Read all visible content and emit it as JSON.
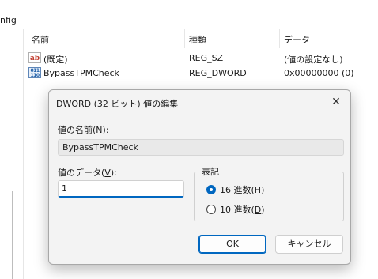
{
  "address": {
    "text": "nfig"
  },
  "list": {
    "columns": {
      "name": "名前",
      "type": "種類",
      "data": "データ"
    },
    "rows": [
      {
        "icon": "ab",
        "name": "(既定)",
        "type": "REG_SZ",
        "data": "(値の設定なし)"
      },
      {
        "icon": "011\n110",
        "name": "BypassTPMCheck",
        "type": "REG_DWORD",
        "data": "0x00000000 (0)"
      }
    ]
  },
  "dialog": {
    "title": "DWORD (32 ビット) 値の編集",
    "close": "✕",
    "name_label": "値の名前(",
    "name_key": "N",
    "name_label_end": "):",
    "name_value": "BypassTPMCheck",
    "data_label": "値のデータ(",
    "data_key": "V",
    "data_label_end": "):",
    "data_value": "1",
    "base_label": "表記",
    "radio_hex": "16 進数(",
    "radio_hex_key": "H",
    "radio_hex_end": ")",
    "radio_dec": "10 進数(",
    "radio_dec_key": "D",
    "radio_dec_end": ")",
    "selected_base": "hex",
    "ok": "OK",
    "cancel": "キャンセル"
  }
}
